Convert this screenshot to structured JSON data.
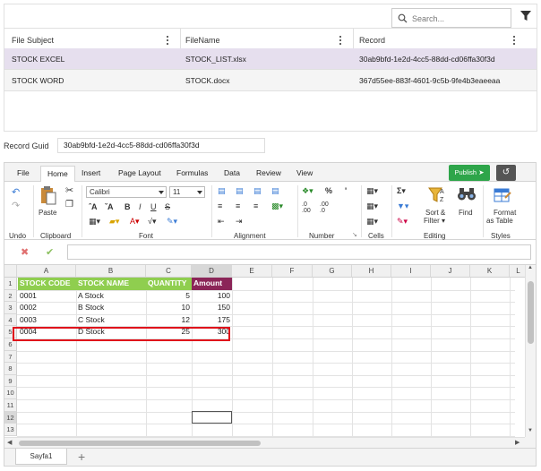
{
  "top_grid": {
    "search_placeholder": "Search...",
    "columns": [
      "File Subject",
      "FileName",
      "Record"
    ],
    "rows": [
      {
        "subject": "STOCK EXCEL",
        "filename": "STOCK_LIST.xlsx",
        "record": "30ab9bfd-1e2d-4cc5-88dd-cd06ffa30f3d",
        "selected": true
      },
      {
        "subject": "STOCK WORD",
        "filename": "STOCK.docx",
        "record": "367d55ee-883f-4601-9c5b-9fe4b3eaeeaa",
        "selected": false
      }
    ]
  },
  "record_guid": {
    "label": "Record Guid",
    "value": "30ab9bfd-1e2d-4cc5-88dd-cd06ffa30f3d"
  },
  "spreadsheet": {
    "tabs": [
      "File",
      "Home",
      "Insert",
      "Page Layout",
      "Formulas",
      "Data",
      "Review",
      "View"
    ],
    "active_tab": "Home",
    "publish_label": "Publish",
    "ribbon": {
      "groups": [
        "Undo",
        "Clipboard",
        "Font",
        "Alignment",
        "Number",
        "Cells",
        "Editing",
        "Styles"
      ],
      "paste_label": "Paste",
      "font_name": "Calibri",
      "font_size": "11",
      "sort_filter_label": "Sort &",
      "sort_filter_label2": "Filter",
      "find_label": "Find",
      "format_table_label": "Format",
      "format_table_label2": "as Table",
      "number_percent": "%",
      "number_comma": "'"
    },
    "column_headers": [
      "A",
      "B",
      "C",
      "D",
      "E",
      "F",
      "G",
      "H",
      "I",
      "J",
      "K",
      "L"
    ],
    "row_numbers": [
      "1",
      "2",
      "3",
      "4",
      "5",
      "6",
      "7",
      "8",
      "9",
      "10",
      "11",
      "12",
      "13"
    ],
    "header_row": [
      "STOCK CODE",
      "STOCK NAME",
      "QUANTITY",
      "Amount"
    ],
    "data_rows": [
      [
        "0001",
        "A Stock",
        "5",
        "100"
      ],
      [
        "0002",
        "B Stock",
        "10",
        "150"
      ],
      [
        "0003",
        "C Stock",
        "12",
        "175"
      ],
      [
        "0004",
        "D Stock",
        "25",
        "300"
      ]
    ],
    "sheet_tab": "Sayfa1",
    "colors": {
      "header_green": "#8fce4f",
      "header_maroon": "#8b2558",
      "publish_green": "#2ea54a",
      "highlight_red": "#e0111b",
      "selected_row": "#e6dfee"
    }
  }
}
